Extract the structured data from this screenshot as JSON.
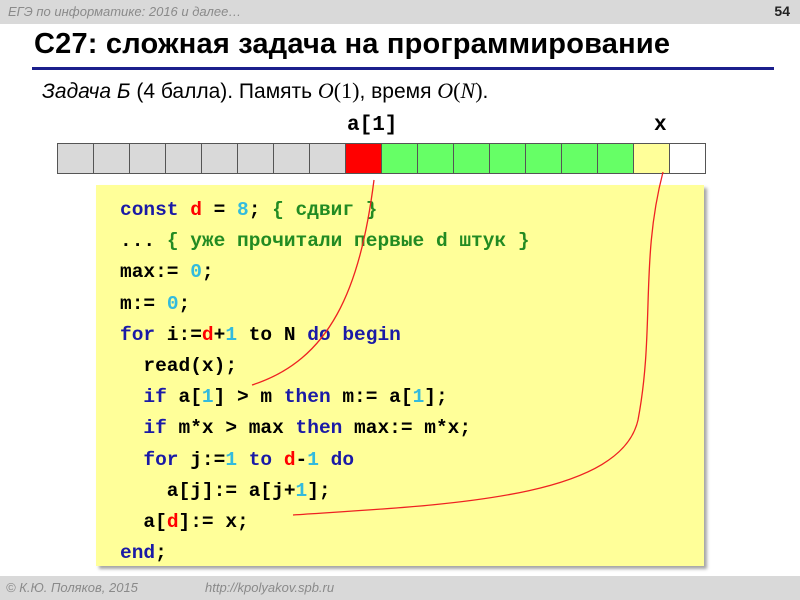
{
  "header": {
    "course": "ЕГЭ по информатике: 2016 и далее…",
    "page_number": "54"
  },
  "title": "С27: сложная задача на программирование",
  "subtitle": {
    "task": "Задача Б",
    "points": " (4 балла). Память ",
    "memory_complexity": {
      "O": "O",
      "open": "(",
      "arg": "1",
      "close": ")"
    },
    "time_label": ",  время ",
    "time_complexity": {
      "O": "O",
      "open": "(",
      "arg": "N",
      "close": ")"
    },
    "end": "."
  },
  "array": {
    "labels": {
      "a1": "a[1]",
      "x": "x"
    },
    "cells": [
      {
        "state": "grey"
      },
      {
        "state": "grey"
      },
      {
        "state": "grey"
      },
      {
        "state": "grey"
      },
      {
        "state": "grey"
      },
      {
        "state": "grey"
      },
      {
        "state": "grey"
      },
      {
        "state": "grey"
      },
      {
        "state": "red"
      },
      {
        "state": "green"
      },
      {
        "state": "green"
      },
      {
        "state": "green"
      },
      {
        "state": "green"
      },
      {
        "state": "green"
      },
      {
        "state": "green"
      },
      {
        "state": "green"
      },
      {
        "state": "yellow"
      },
      {
        "state": "white"
      }
    ],
    "colors": {
      "grey": "#d9d9d9",
      "red": "#ff0000",
      "green": "#66ff66",
      "yellow": "#ffff99",
      "white": "#ffffff"
    }
  },
  "code": {
    "lines": [
      [
        [
          "kw",
          "const"
        ],
        [
          "t",
          " "
        ],
        [
          "var",
          "d"
        ],
        [
          "t",
          " = "
        ],
        [
          "num",
          "8"
        ],
        [
          "t",
          "; "
        ],
        [
          "cm",
          "{ сдвиг }"
        ]
      ],
      [
        [
          "t",
          "... "
        ],
        [
          "cm",
          "{ уже прочитали первые d штук }"
        ]
      ],
      [
        [
          "t",
          "max:= "
        ],
        [
          "num",
          "0"
        ],
        [
          "t",
          ";"
        ]
      ],
      [
        [
          "t",
          "m:= "
        ],
        [
          "num",
          "0"
        ],
        [
          "t",
          ";"
        ]
      ],
      [
        [
          "kw",
          "for"
        ],
        [
          "t",
          " i:="
        ],
        [
          "var",
          "d"
        ],
        [
          "t",
          "+"
        ],
        [
          "num",
          "1"
        ],
        [
          "t",
          " to N "
        ],
        [
          "kw",
          "do"
        ],
        [
          "t",
          " "
        ],
        [
          "kw",
          "begin"
        ]
      ],
      [
        [
          "t",
          "  read(x);"
        ]
      ],
      [
        [
          "t",
          "  "
        ],
        [
          "kw",
          "if"
        ],
        [
          "t",
          " a["
        ],
        [
          "num",
          "1"
        ],
        [
          "t",
          "] > m "
        ],
        [
          "kw",
          "then"
        ],
        [
          "t",
          " m:= a["
        ],
        [
          "num",
          "1"
        ],
        [
          "t",
          "];"
        ]
      ],
      [
        [
          "t",
          "  "
        ],
        [
          "kw",
          "if"
        ],
        [
          "t",
          " m*x > max "
        ],
        [
          "kw",
          "then"
        ],
        [
          "t",
          " max:= m*x;"
        ]
      ],
      [
        [
          "t",
          "  "
        ],
        [
          "kw",
          "for"
        ],
        [
          "t",
          " j:="
        ],
        [
          "num",
          "1"
        ],
        [
          "t",
          " "
        ],
        [
          "kw",
          "to"
        ],
        [
          "t",
          " "
        ],
        [
          "var",
          "d"
        ],
        [
          "t",
          "-"
        ],
        [
          "num",
          "1"
        ],
        [
          "t",
          " "
        ],
        [
          "kw",
          "do"
        ]
      ],
      [
        [
          "t",
          "    a[j]:= a[j+"
        ],
        [
          "num",
          "1"
        ],
        [
          "t",
          "];"
        ]
      ],
      [
        [
          "t",
          "  a["
        ],
        [
          "var",
          "d"
        ],
        [
          "t",
          "]:= x;"
        ]
      ],
      [
        [
          "kw",
          "end"
        ],
        [
          "t",
          ";"
        ]
      ]
    ],
    "colors": {
      "keyword": "#1a1aa6",
      "variable": "#ff0000",
      "number": "#33bbdd",
      "comment": "#228b22",
      "background": "#ffff99"
    }
  },
  "footer": {
    "copyright": "© К.Ю. Поляков, 2015",
    "url": "http://kpolyakov.spb.ru"
  }
}
